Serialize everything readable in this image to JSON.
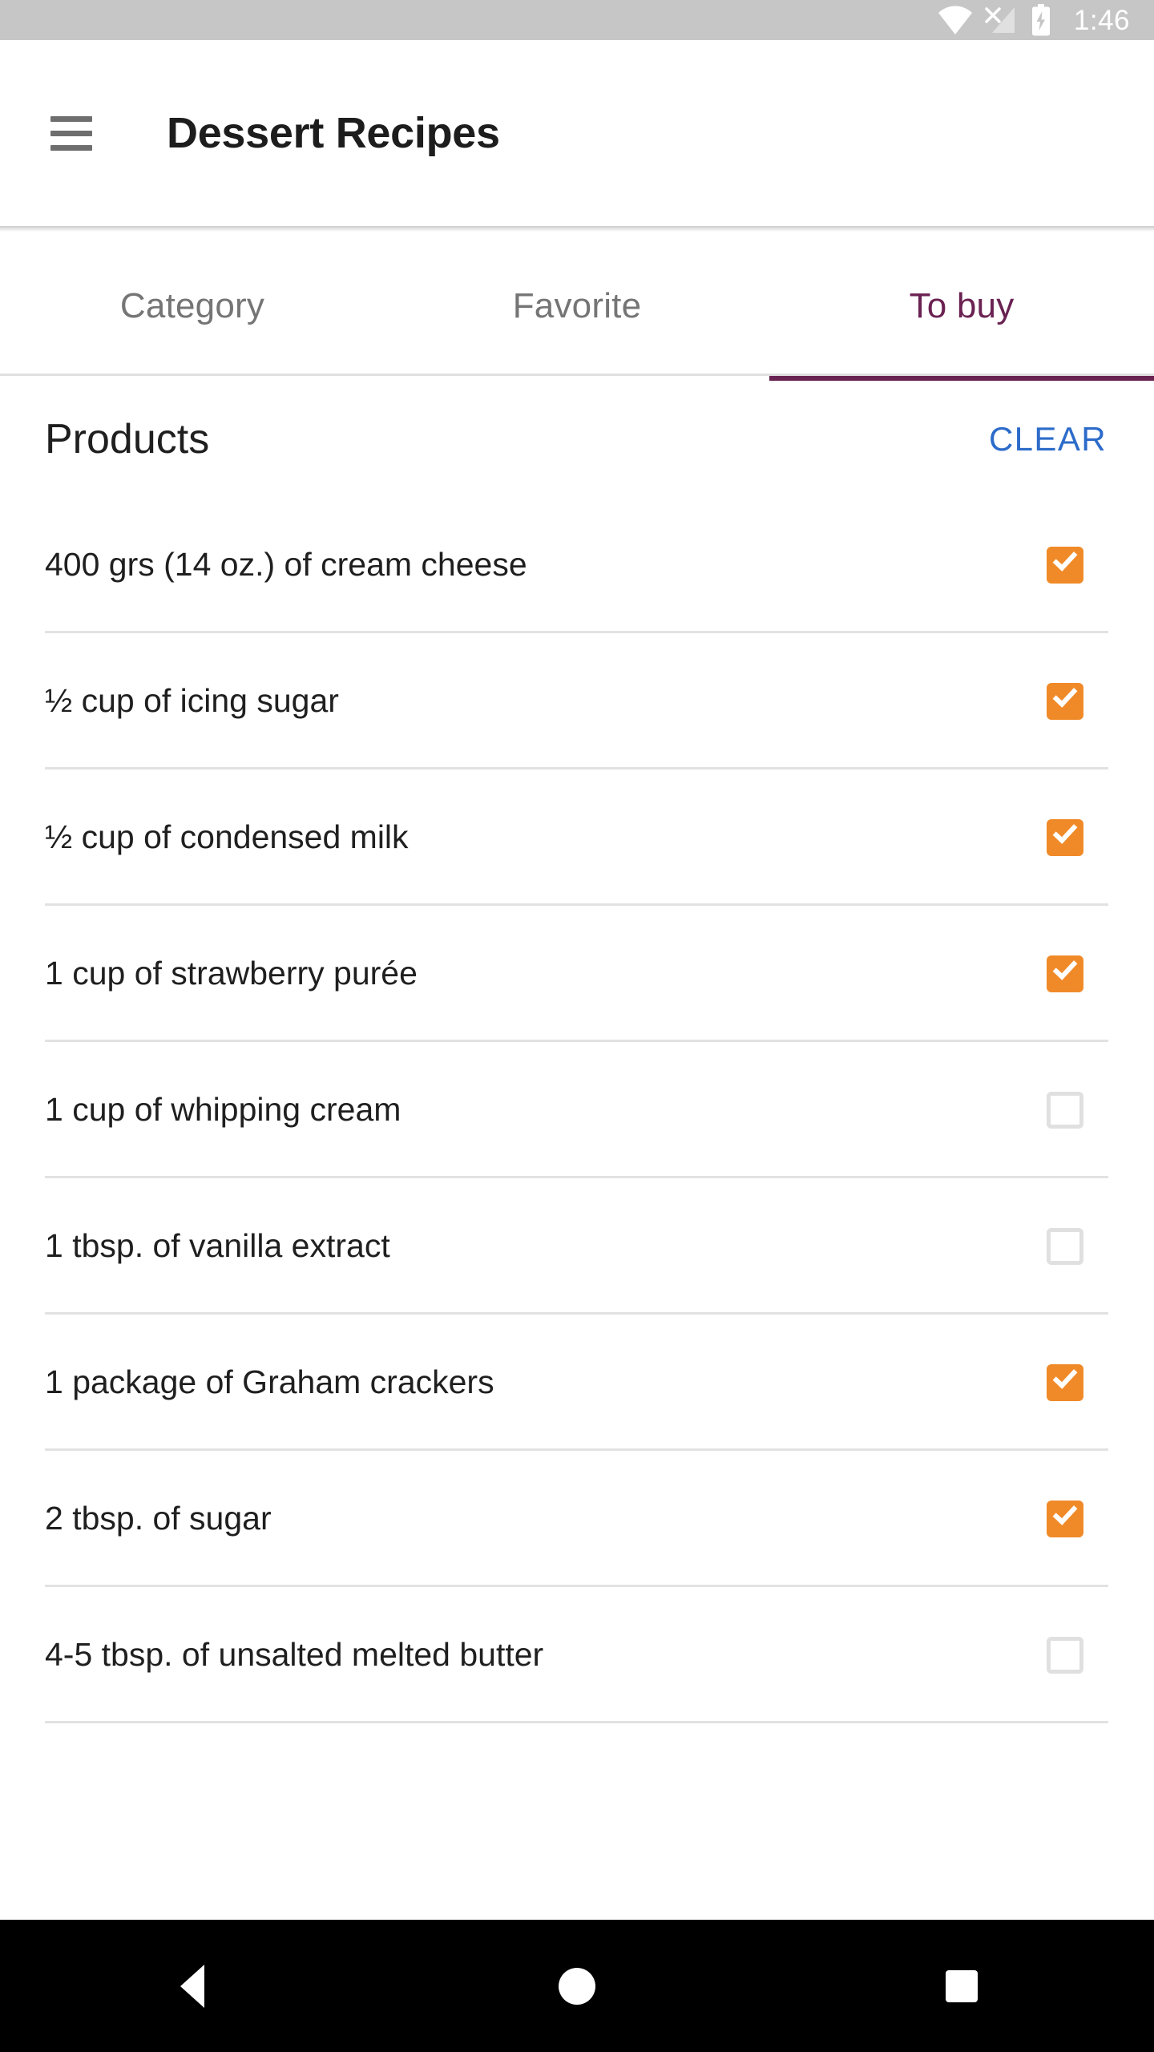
{
  "status_bar": {
    "time": "1:46",
    "icons": [
      "wifi-icon",
      "cellular-no-sim-icon",
      "battery-charging-icon"
    ],
    "background": "#c6c6c6"
  },
  "app_bar": {
    "menu_icon": "hamburger-menu-icon",
    "title": "Dessert Recipes"
  },
  "tabs": {
    "items": [
      {
        "label": "Category",
        "active": false
      },
      {
        "label": "Favorite",
        "active": false
      },
      {
        "label": "To buy",
        "active": true
      }
    ],
    "active_color": "#6a2252",
    "inactive_color": "#757575"
  },
  "section": {
    "title": "Products",
    "clear_label": "CLEAR",
    "clear_color": "#2c6bc9"
  },
  "products": {
    "checked_color": "#f08a28",
    "unchecked_color": "#e0e0e0",
    "items": [
      {
        "label": "400 grs (14 oz.) of cream cheese",
        "checked": true
      },
      {
        "label": "½ cup of icing sugar",
        "checked": true
      },
      {
        "label": "½ cup of condensed milk",
        "checked": true
      },
      {
        "label": "1 cup of strawberry purée",
        "checked": true
      },
      {
        "label": "1 cup of whipping cream",
        "checked": false
      },
      {
        "label": "1 tbsp. of vanilla extract",
        "checked": false
      },
      {
        "label": "1 package of Graham crackers",
        "checked": true
      },
      {
        "label": "2 tbsp. of sugar",
        "checked": true
      },
      {
        "label": "4-5 tbsp. of unsalted melted butter",
        "checked": false
      }
    ]
  },
  "nav_bar": {
    "back_icon": "triangle-back-icon",
    "home_icon": "circle-home-icon",
    "recents_icon": "square-recents-icon"
  }
}
